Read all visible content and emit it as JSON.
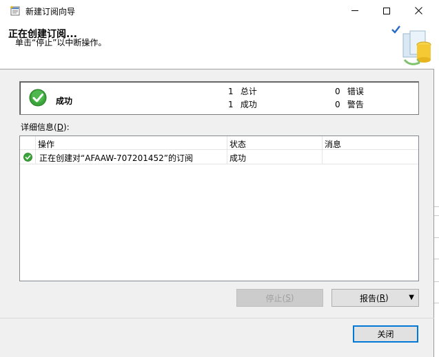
{
  "window": {
    "title": "新建订阅向导",
    "title_icon": "wizard-icon"
  },
  "header": {
    "title": "正在创建订阅...",
    "subtitle": "单击“停止”以中断操作。",
    "art_icon": "database-wizard-icon"
  },
  "summary": {
    "status": "成功",
    "status_icon": "success-check-icon",
    "total": {
      "count": "1",
      "label": "总计"
    },
    "success": {
      "count": "1",
      "label": "成功"
    },
    "error": {
      "count": "0",
      "label": "错误"
    },
    "warning": {
      "count": "0",
      "label": "警告"
    }
  },
  "details": {
    "label": "详细信息(",
    "label_key": "D",
    "label_end": "):",
    "columns": [
      "操作",
      "状态",
      "消息"
    ],
    "rows": [
      {
        "action": "正在创建对“AFAAW-707201452”的订阅",
        "status": "成功",
        "message": ""
      }
    ]
  },
  "buttons": {
    "stop": {
      "label": "停止(",
      "key": "S",
      "end": ")"
    },
    "report": {
      "label": "报告(",
      "key": "R",
      "end": ")"
    },
    "close": "关闭"
  },
  "colors": {
    "accent": "#0078d7",
    "success": "#3aa53a"
  }
}
